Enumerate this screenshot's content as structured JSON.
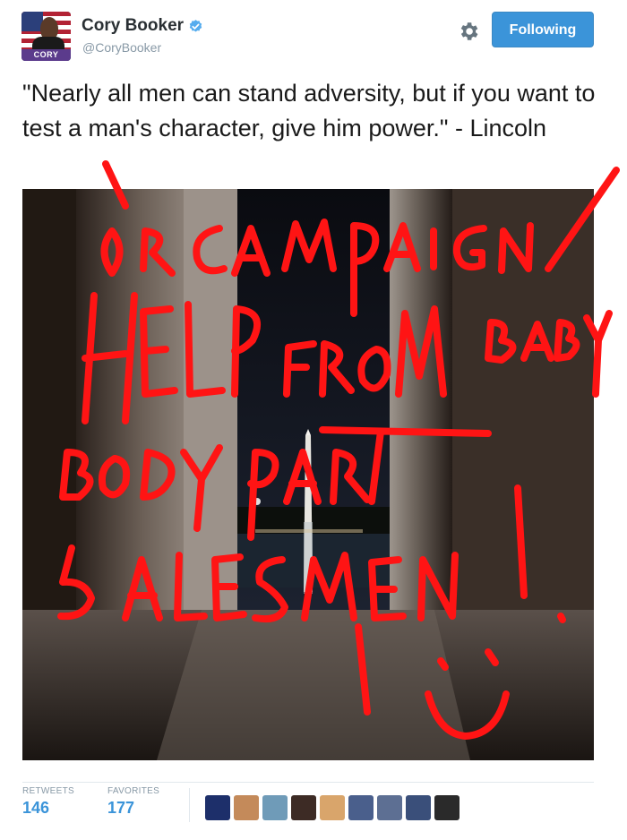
{
  "user": {
    "name": "Cory Booker",
    "handle": "@CoryBooker",
    "avatar_tag": "CORY",
    "verified": true
  },
  "follow_button": {
    "label": "Following"
  },
  "tweet": {
    "text": "\"Nearly all men can stand adversity, but if you want to test a man's character, give him power.\" - Lincoln"
  },
  "stats": {
    "retweets_label": "RETWEETS",
    "retweets_count": "146",
    "favorites_label": "FAVORITES",
    "favorites_count": "177"
  },
  "favoriters": [
    {
      "color": "#1d2f6a"
    },
    {
      "color": "#c48a5a"
    },
    {
      "color": "#6f9bb8"
    },
    {
      "color": "#3d2b25"
    },
    {
      "color": "#d9a56b"
    },
    {
      "color": "#4a5f8c"
    },
    {
      "color": "#5d6f93"
    },
    {
      "color": "#3a4f7a"
    },
    {
      "color": "#2a2a2a"
    }
  ],
  "colors": {
    "accent": "#3b94d9",
    "scribble": "#ff1414"
  }
}
